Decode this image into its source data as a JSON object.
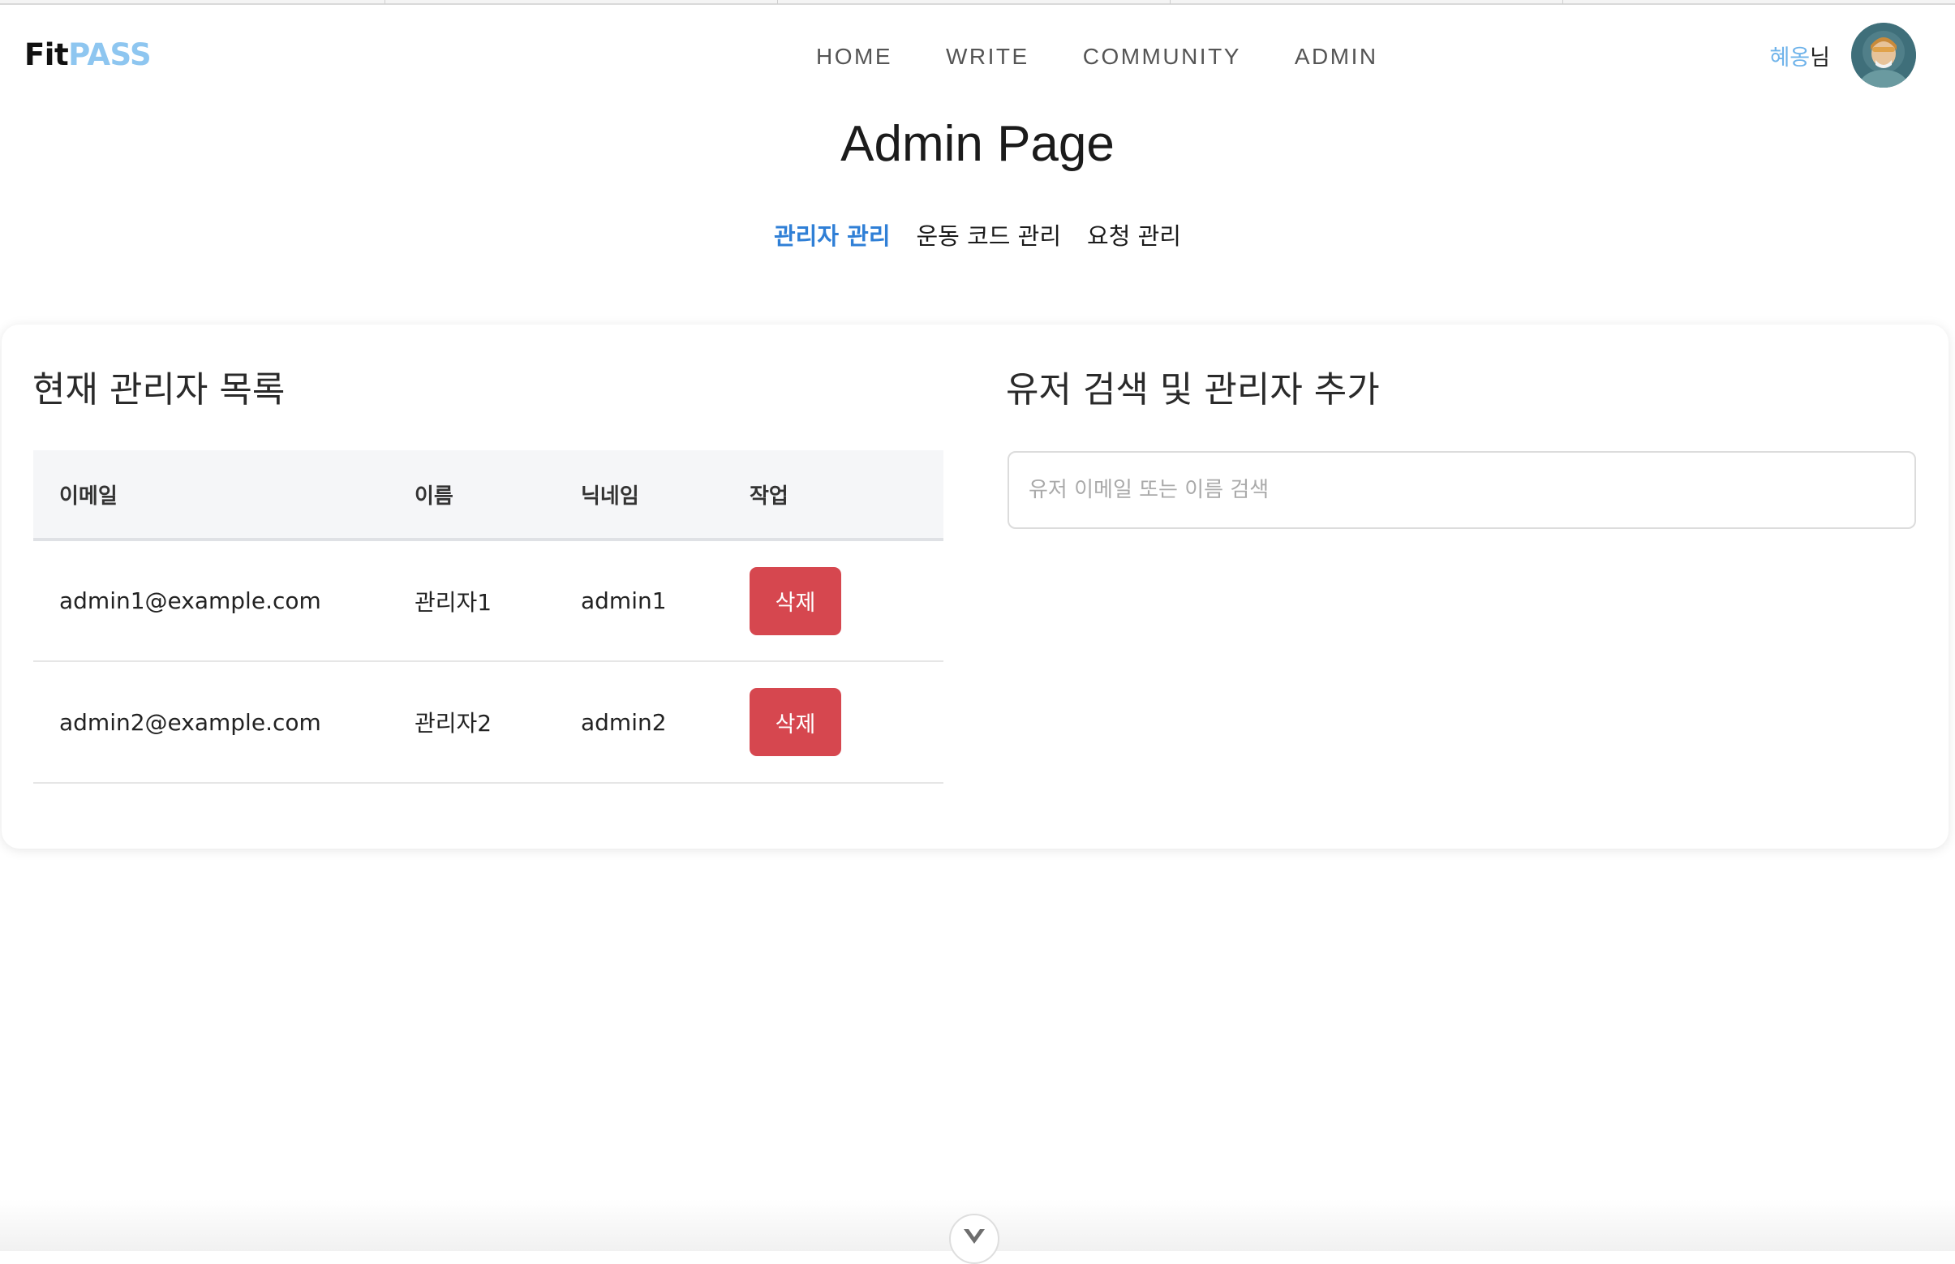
{
  "header": {
    "logo_part1": "Fit",
    "logo_part2": "PASS",
    "nav": [
      "HOME",
      "WRITE",
      "COMMUNITY",
      "ADMIN"
    ],
    "user_nick": "혜옹",
    "user_suffix": "님"
  },
  "page": {
    "title": "Admin Page",
    "tabs": [
      "관리자 관리",
      "운동 코드 관리",
      "요청 관리"
    ],
    "active_tab": "관리자 관리"
  },
  "admin_list": {
    "title": "현재 관리자 목록",
    "columns": [
      "이메일",
      "이름",
      "닉네임",
      "작업"
    ],
    "rows": [
      {
        "email": "admin1@example.com",
        "name": "관리자1",
        "nickname": "admin1",
        "action": "삭제"
      },
      {
        "email": "admin2@example.com",
        "name": "관리자2",
        "nickname": "admin2",
        "action": "삭제"
      }
    ]
  },
  "user_search": {
    "title": "유저 검색 및 관리자 추가",
    "placeholder": "유저 이메일 또는 이름 검색",
    "value": ""
  },
  "colors": {
    "accent": "#2f7fd6",
    "logo_accent": "#8ec6f0",
    "danger": "#d6474f"
  },
  "icons": {
    "scroll": "chevron-down-icon",
    "avatar": "user-avatar"
  }
}
